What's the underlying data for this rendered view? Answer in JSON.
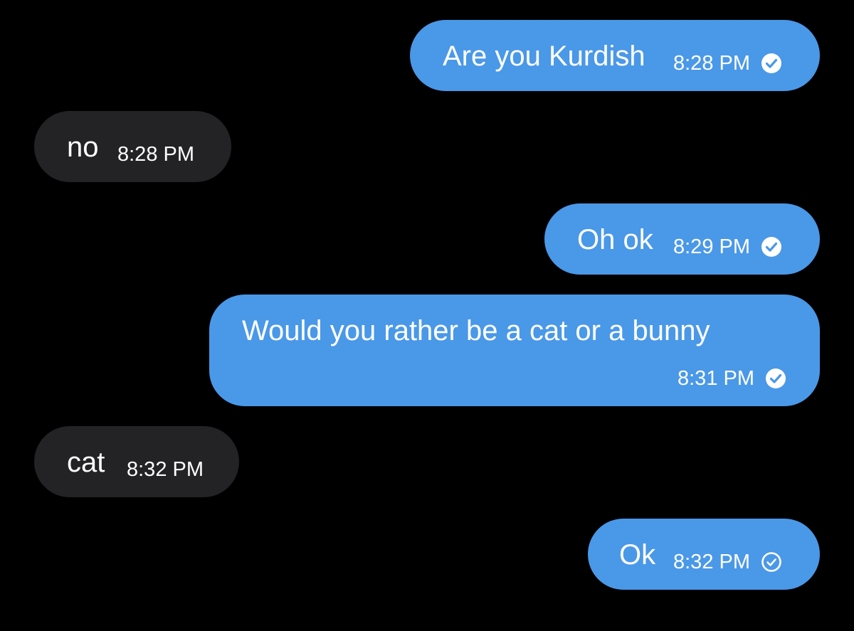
{
  "colors": {
    "background": "#000000",
    "sent_bubble": "#4a98e8",
    "received_bubble": "#232326",
    "text": "#ffffff"
  },
  "messages": [
    {
      "direction": "sent",
      "text": "Are you Kurdish",
      "time": "8:28 PM",
      "status_icon": "check-circle-filled-icon"
    },
    {
      "direction": "received",
      "text": "no",
      "time": "8:28 PM"
    },
    {
      "direction": "sent",
      "text": "Oh ok",
      "time": "8:29 PM",
      "status_icon": "check-circle-filled-icon"
    },
    {
      "direction": "sent",
      "text": "Would you rather be a cat or a bunny",
      "time": "8:31 PM",
      "status_icon": "check-circle-filled-icon"
    },
    {
      "direction": "received",
      "text": "cat",
      "time": "8:32 PM"
    },
    {
      "direction": "sent",
      "text": "Ok",
      "time": "8:32 PM",
      "status_icon": "check-circle-outline-icon"
    }
  ]
}
